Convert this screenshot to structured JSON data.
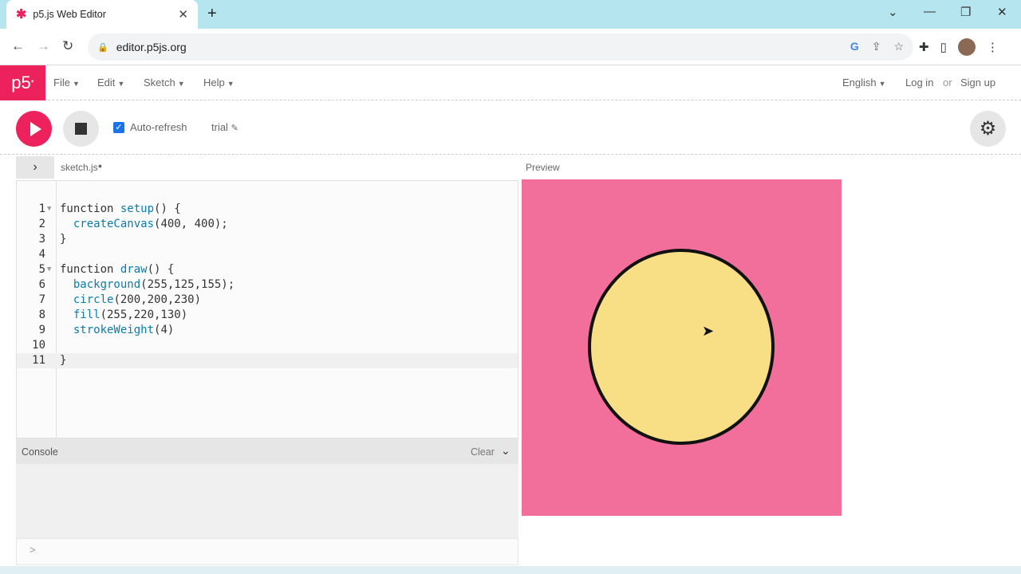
{
  "browser": {
    "tab_title": "p5.js Web Editor",
    "tab_favicon": "p5-asterisk-icon",
    "new_tab_symbol": "+",
    "close_symbol": "✕",
    "url": "editor.p5js.org"
  },
  "nav": {
    "logo": "p5",
    "logo_sup": "*",
    "menus": [
      "File",
      "Edit",
      "Sketch",
      "Help"
    ],
    "language": "English",
    "login": "Log in",
    "or": "or",
    "signup": "Sign up"
  },
  "toolbar": {
    "auto_refresh_label": "Auto-refresh",
    "auto_refresh_checked": true,
    "sketch_name": "trial"
  },
  "editor": {
    "filename": "sketch.js",
    "lines": [
      {
        "n": "1",
        "fold": true,
        "text": "function setup() {"
      },
      {
        "n": "2",
        "fold": false,
        "text": "  createCanvas(400, 400);"
      },
      {
        "n": "3",
        "fold": false,
        "text": "}"
      },
      {
        "n": "4",
        "fold": false,
        "text": ""
      },
      {
        "n": "5",
        "fold": true,
        "text": "function draw() {"
      },
      {
        "n": "6",
        "fold": false,
        "text": "  background(255,125,155);"
      },
      {
        "n": "7",
        "fold": false,
        "text": "  circle(200,200,230)"
      },
      {
        "n": "8",
        "fold": false,
        "text": "  fill(255,220,130)"
      },
      {
        "n": "9",
        "fold": false,
        "text": "  strokeWeight(4)"
      },
      {
        "n": "10",
        "fold": false,
        "text": ""
      },
      {
        "n": "11",
        "fold": false,
        "text": "}"
      }
    ],
    "active_line": 11
  },
  "console": {
    "label": "Console",
    "clear": "Clear",
    "prompt": ">"
  },
  "preview": {
    "label": "Preview",
    "background_color": "#f26e9b",
    "circle_fill": "#f8df86",
    "circle_stroke": "#111111"
  },
  "colors": {
    "accent": "#ed225d",
    "tabstrip": "#b5e5ee"
  }
}
